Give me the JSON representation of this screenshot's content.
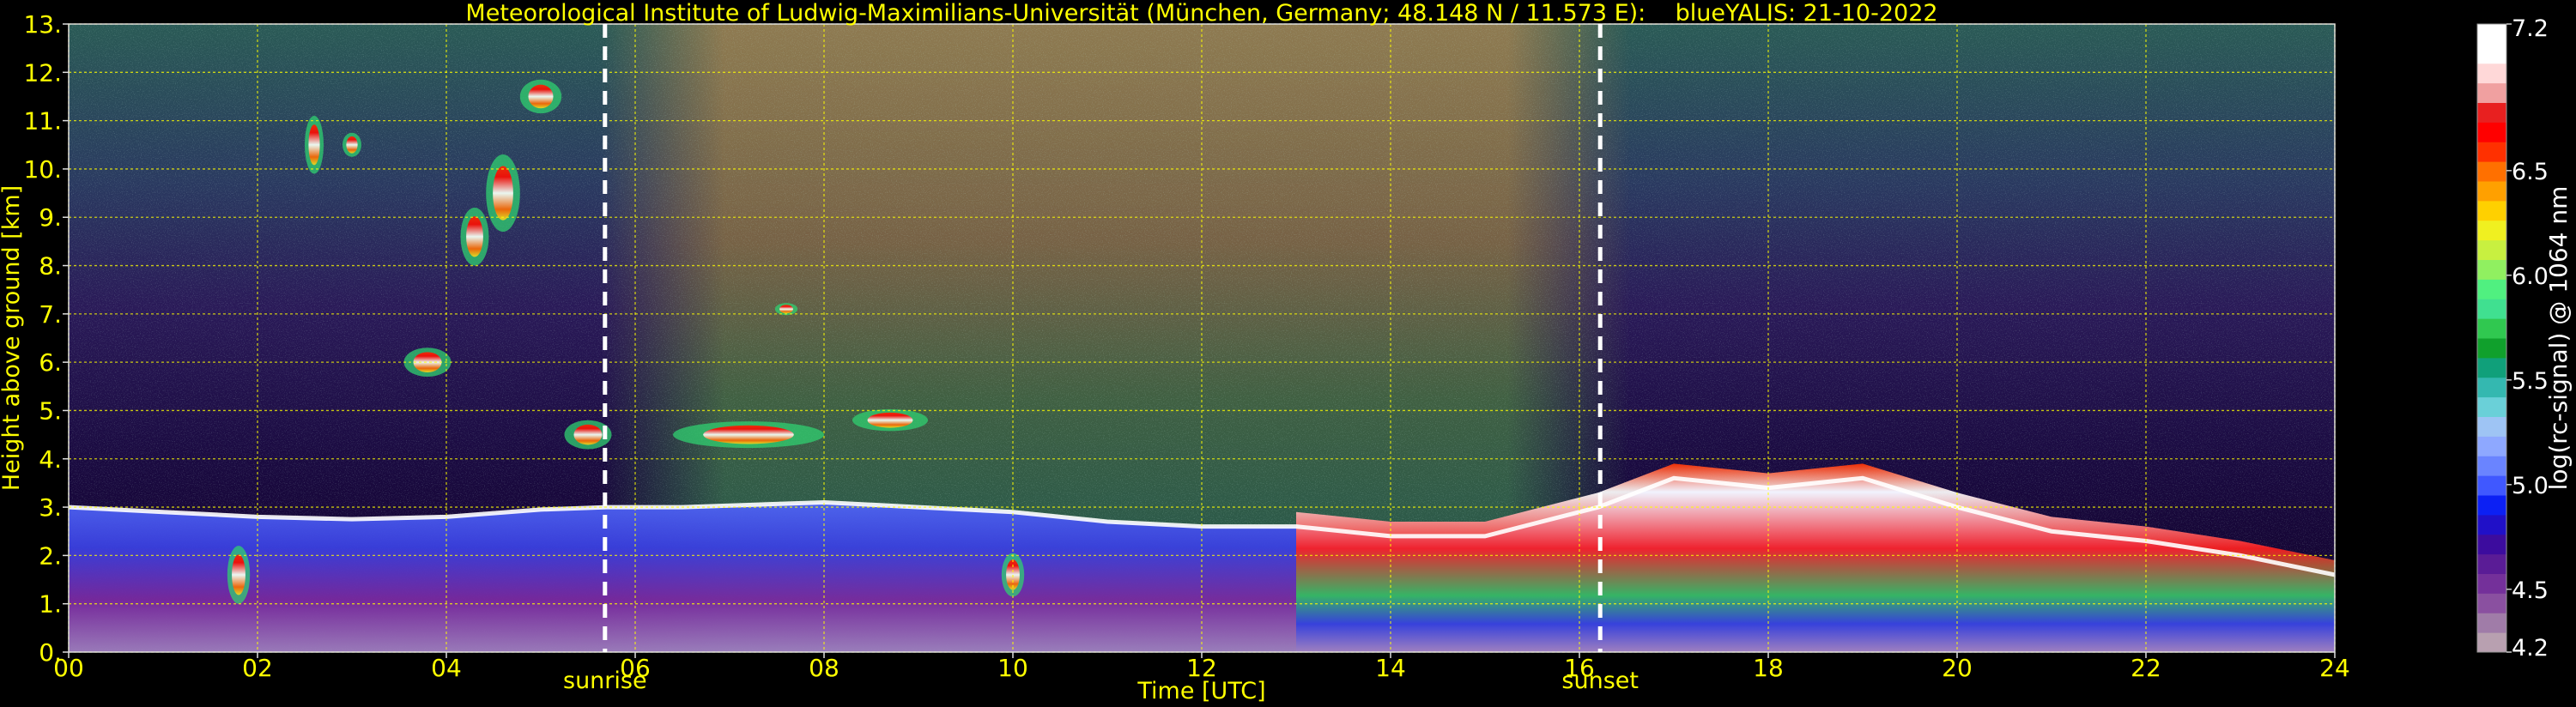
{
  "chart_data": {
    "type": "heatmap",
    "title": "Meteorological Institute of Ludwig-Maximilians-Universität (München, Germany; 48.148 N / 11.573 E):    blueYALIS: 21-10-2022",
    "xlabel": "Time [UTC]",
    "ylabel": "Height above ground [km]",
    "xlim": [
      0,
      24
    ],
    "ylim": [
      0,
      13
    ],
    "x_ticks": [
      0,
      2,
      4,
      6,
      8,
      10,
      12,
      14,
      16,
      18,
      20,
      22,
      24
    ],
    "x_tick_labels": [
      "00",
      "02",
      "04",
      "06",
      "08",
      "10",
      "12",
      "14",
      "16",
      "18",
      "20",
      "22",
      "24"
    ],
    "y_ticks": [
      0,
      1,
      2,
      3,
      4,
      5,
      6,
      7,
      8,
      9,
      10,
      11,
      12,
      13
    ],
    "y_tick_labels": [
      "0.",
      "1.",
      "2.",
      "3.",
      "4.",
      "5.",
      "6.",
      "7.",
      "8.",
      "9.",
      "10.",
      "11.",
      "12.",
      "13."
    ],
    "grid": true,
    "grid_color": "#ffff00",
    "annotations": [
      {
        "label": "sunrise",
        "x": 5.68
      },
      {
        "label": "sunset",
        "x": 16.22
      }
    ],
    "colorbar": {
      "label": "log(rc-signal) @ 1064 nm",
      "min": 4.2,
      "max": 7.2,
      "tick_values": [
        4.2,
        4.5,
        5.0,
        5.5,
        6.0,
        6.5,
        7.2
      ],
      "tick_labels": [
        "4.2",
        "4.5",
        "5.0",
        "5.5",
        "6.0",
        "6.5",
        "7.2"
      ],
      "colors": [
        "#b8a0b0",
        "#a07ca8",
        "#8a50a0",
        "#74309a",
        "#5a1c96",
        "#3c0c9e",
        "#2010c8",
        "#0c20f4",
        "#4058ff",
        "#6a84ff",
        "#8ea8ff",
        "#9ec4f4",
        "#6ad0d8",
        "#34b8b0",
        "#10a07a",
        "#10a02c",
        "#30c850",
        "#40e090",
        "#50f080",
        "#90f060",
        "#c8f040",
        "#f0f020",
        "#ffd000",
        "#ffa000",
        "#ff7000",
        "#ff3000",
        "#ff0000",
        "#e82020",
        "#f0a0a0",
        "#ffd8d8",
        "#ffffff",
        "#ffffff"
      ]
    },
    "boundary_layer_top_km": [
      {
        "t": 0.0,
        "h": 3.0
      },
      {
        "t": 1.0,
        "h": 2.9
      },
      {
        "t": 2.0,
        "h": 2.8
      },
      {
        "t": 3.0,
        "h": 2.75
      },
      {
        "t": 4.0,
        "h": 2.8
      },
      {
        "t": 5.0,
        "h": 2.95
      },
      {
        "t": 5.7,
        "h": 3.0
      },
      {
        "t": 6.5,
        "h": 3.0
      },
      {
        "t": 8.0,
        "h": 3.1
      },
      {
        "t": 9.0,
        "h": 3.0
      },
      {
        "t": 10.0,
        "h": 2.9
      },
      {
        "t": 11.0,
        "h": 2.7
      },
      {
        "t": 12.0,
        "h": 2.6
      },
      {
        "t": 13.0,
        "h": 2.6
      },
      {
        "t": 14.0,
        "h": 2.4
      },
      {
        "t": 15.0,
        "h": 2.4
      },
      {
        "t": 16.2,
        "h": 3.0
      },
      {
        "t": 17.0,
        "h": 3.6
      },
      {
        "t": 18.0,
        "h": 3.4
      },
      {
        "t": 19.0,
        "h": 3.6
      },
      {
        "t": 20.0,
        "h": 3.0
      },
      {
        "t": 21.0,
        "h": 2.5
      },
      {
        "t": 22.0,
        "h": 2.3
      },
      {
        "t": 23.0,
        "h": 2.0
      },
      {
        "t": 24.0,
        "h": 1.6
      }
    ]
  }
}
